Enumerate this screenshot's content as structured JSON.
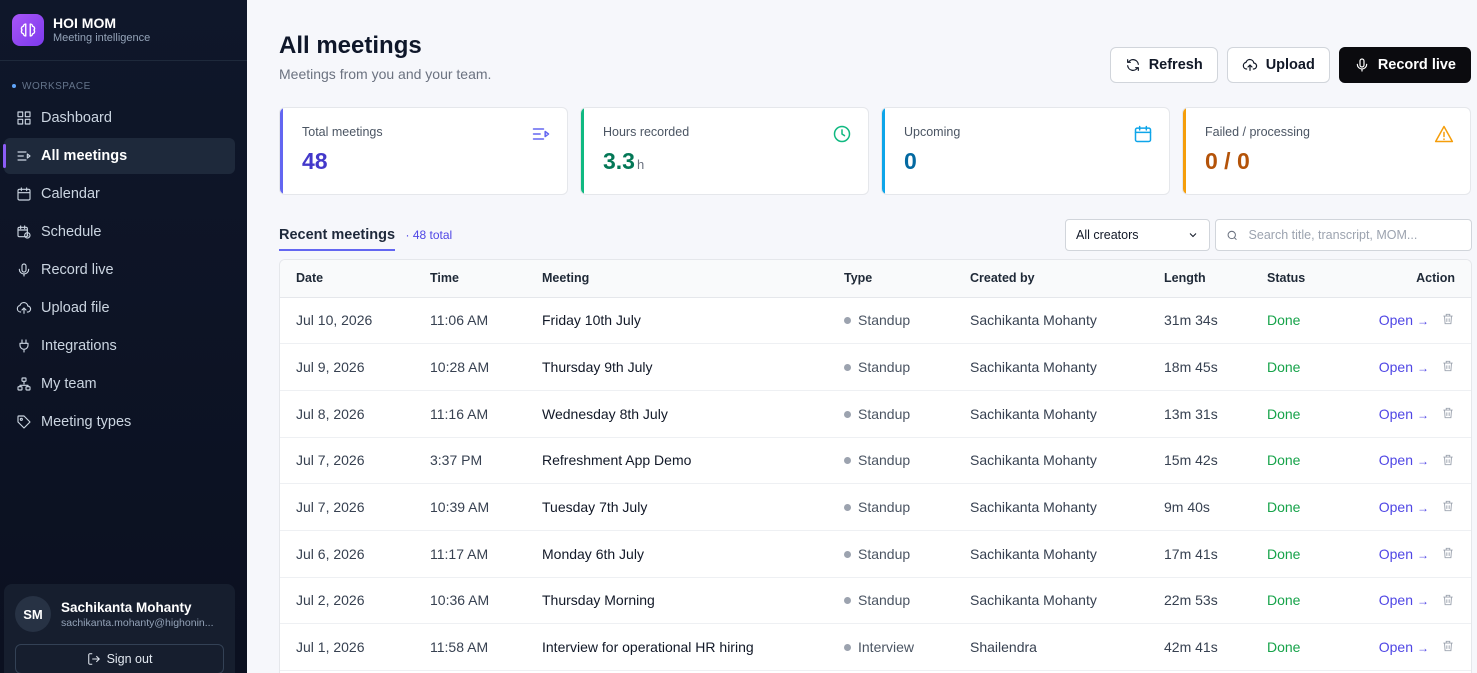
{
  "brand": {
    "name": "HOI MOM",
    "subtitle": "Meeting intelligence"
  },
  "sidebar": {
    "section_label": "WORKSPACE",
    "items": [
      {
        "label": "Dashboard",
        "icon": "dashboard-icon"
      },
      {
        "label": "All meetings",
        "icon": "list-icon",
        "active": true
      },
      {
        "label": "Calendar",
        "icon": "calendar-icon"
      },
      {
        "label": "Schedule",
        "icon": "schedule-icon"
      },
      {
        "label": "Record live",
        "icon": "microphone-icon"
      },
      {
        "label": "Upload file",
        "icon": "upload-icon"
      },
      {
        "label": "Integrations",
        "icon": "plug-icon"
      },
      {
        "label": "My team",
        "icon": "team-icon"
      },
      {
        "label": "Meeting types",
        "icon": "tag-icon"
      }
    ]
  },
  "user": {
    "initials": "SM",
    "name": "Sachikanta Mohanty",
    "email": "sachikanta.mohanty@highonin...",
    "signout_label": "Sign out"
  },
  "header": {
    "title": "All meetings",
    "subtitle": "Meetings from you and your team.",
    "refresh_label": "Refresh",
    "upload_label": "Upload",
    "record_label": "Record live"
  },
  "stats": [
    {
      "label": "Total meetings",
      "value": "48",
      "unit": "",
      "icon": "list-icon",
      "color": "#6366f1"
    },
    {
      "label": "Hours recorded",
      "value": "3.3",
      "unit": "h",
      "icon": "clock-icon",
      "color": "#10b981"
    },
    {
      "label": "Upcoming",
      "value": "0",
      "unit": "",
      "icon": "calendar-icon",
      "color": "#0ea5e9"
    },
    {
      "label": "Failed / processing",
      "value": "0 / 0",
      "unit": "",
      "icon": "warning-icon",
      "color": "#f59e0b"
    }
  ],
  "list": {
    "tab_label": "Recent meetings",
    "count_label": "· 48 total",
    "filter_value": "All creators",
    "search_placeholder": "Search title, transcript, MOM..."
  },
  "table": {
    "columns": [
      "Date",
      "Time",
      "Meeting",
      "Type",
      "Created by",
      "Length",
      "Status",
      "Action"
    ],
    "open_label": "Open",
    "rows": [
      {
        "date": "Jul 10, 2026",
        "time": "11:06 AM",
        "meeting": "Friday 10th July",
        "type": "Standup",
        "creator": "Sachikanta Mohanty",
        "length": "31m 34s",
        "status": "Done"
      },
      {
        "date": "Jul 9, 2026",
        "time": "10:28 AM",
        "meeting": "Thursday 9th July",
        "type": "Standup",
        "creator": "Sachikanta Mohanty",
        "length": "18m 45s",
        "status": "Done"
      },
      {
        "date": "Jul 8, 2026",
        "time": "11:16 AM",
        "meeting": "Wednesday 8th July",
        "type": "Standup",
        "creator": "Sachikanta Mohanty",
        "length": "13m 31s",
        "status": "Done"
      },
      {
        "date": "Jul 7, 2026",
        "time": "3:37 PM",
        "meeting": "Refreshment App Demo",
        "type": "Standup",
        "creator": "Sachikanta Mohanty",
        "length": "15m 42s",
        "status": "Done"
      },
      {
        "date": "Jul 7, 2026",
        "time": "10:39 AM",
        "meeting": "Tuesday 7th July",
        "type": "Standup",
        "creator": "Sachikanta Mohanty",
        "length": "9m 40s",
        "status": "Done"
      },
      {
        "date": "Jul 6, 2026",
        "time": "11:17 AM",
        "meeting": "Monday 6th July",
        "type": "Standup",
        "creator": "Sachikanta Mohanty",
        "length": "17m 41s",
        "status": "Done"
      },
      {
        "date": "Jul 2, 2026",
        "time": "10:36 AM",
        "meeting": "Thursday Morning",
        "type": "Standup",
        "creator": "Sachikanta Mohanty",
        "length": "22m 53s",
        "status": "Done"
      },
      {
        "date": "Jul 1, 2026",
        "time": "11:58 AM",
        "meeting": "Interview for operational HR hiring",
        "type": "Interview",
        "creator": "Shailendra",
        "length": "42m 41s",
        "status": "Done"
      }
    ]
  }
}
